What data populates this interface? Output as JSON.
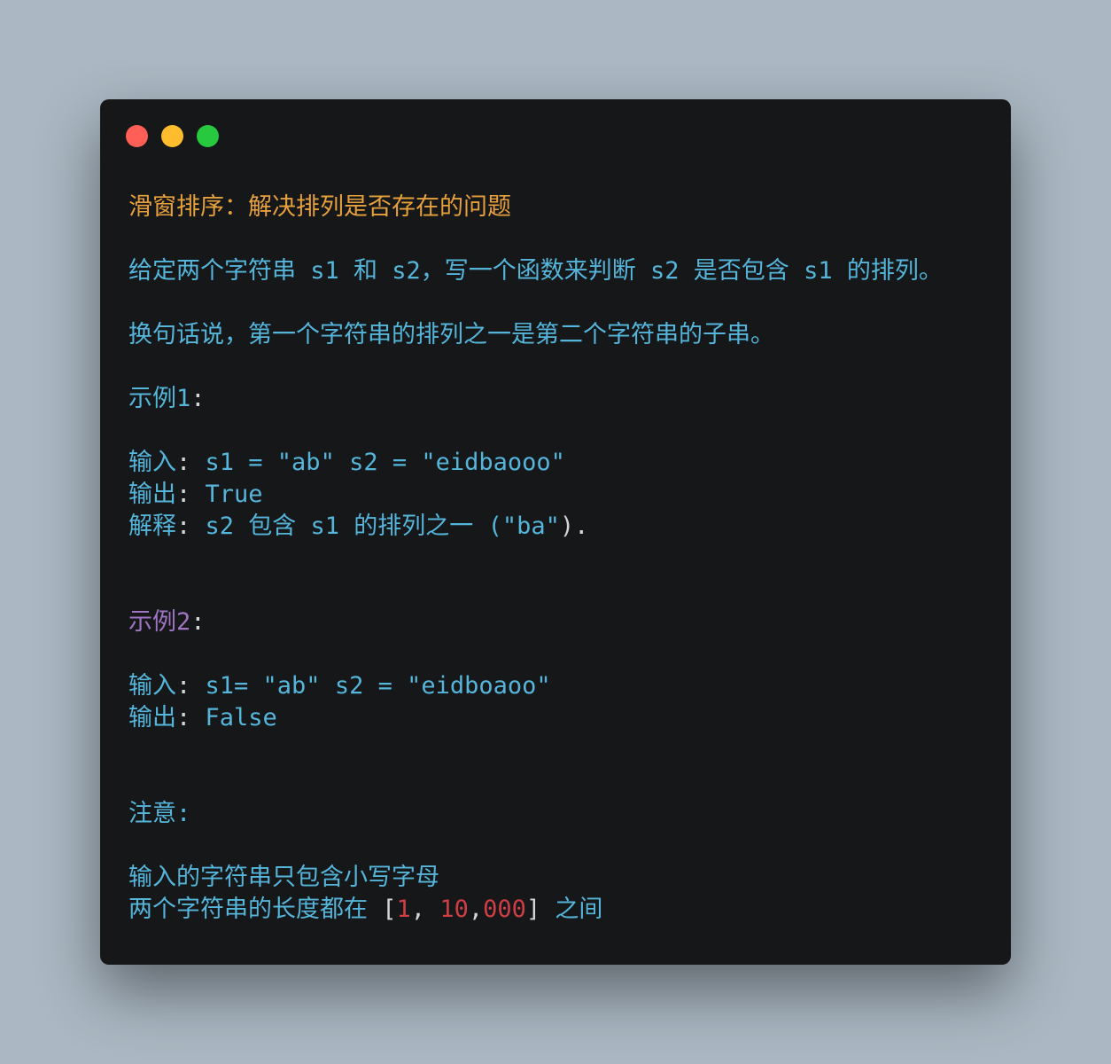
{
  "window": {
    "controls": {
      "close_color": "#ff5f56",
      "minimize_color": "#ffbd2e",
      "maximize_color": "#27c93f"
    }
  },
  "content": {
    "title": "滑窗排序：解决排列是否存在的问题",
    "desc1_a": "给定两个字符串 s1 和 s2，写一个函数来判断 s2 是否包含 s1 的排列。",
    "desc2": "换句话说，第一个字符串的排列之一是第二个字符串的子串。",
    "example1": {
      "heading": "示例1",
      "colon": ":",
      "input_label": "输入",
      "input_value": " s1 = \"ab\" s2 = \"eidbaooo\"",
      "output_label": "输出",
      "output_value": " True",
      "explain_label": "解释",
      "explain_value": " s2 包含 s1 的排列之一 (",
      "explain_quote": "\"ba\"",
      "explain_end": ")."
    },
    "example2": {
      "heading": "示例2",
      "colon": ":",
      "input_label": "输入",
      "input_value": " s1= \"ab\" s2 = \"eidboaoo\"",
      "output_label": "输出",
      "output_value": " False"
    },
    "note": {
      "heading": "注意:",
      "item1": "输入的字符串只包含小写字母",
      "item2_a": "两个字符串的长度都在 ",
      "bracket_open": "[",
      "num1": "1",
      "comma1": ", ",
      "num2": "10",
      "comma2": ",",
      "num3": "000",
      "bracket_close": "]",
      "item2_b": " 之间"
    },
    "colon": ":"
  }
}
